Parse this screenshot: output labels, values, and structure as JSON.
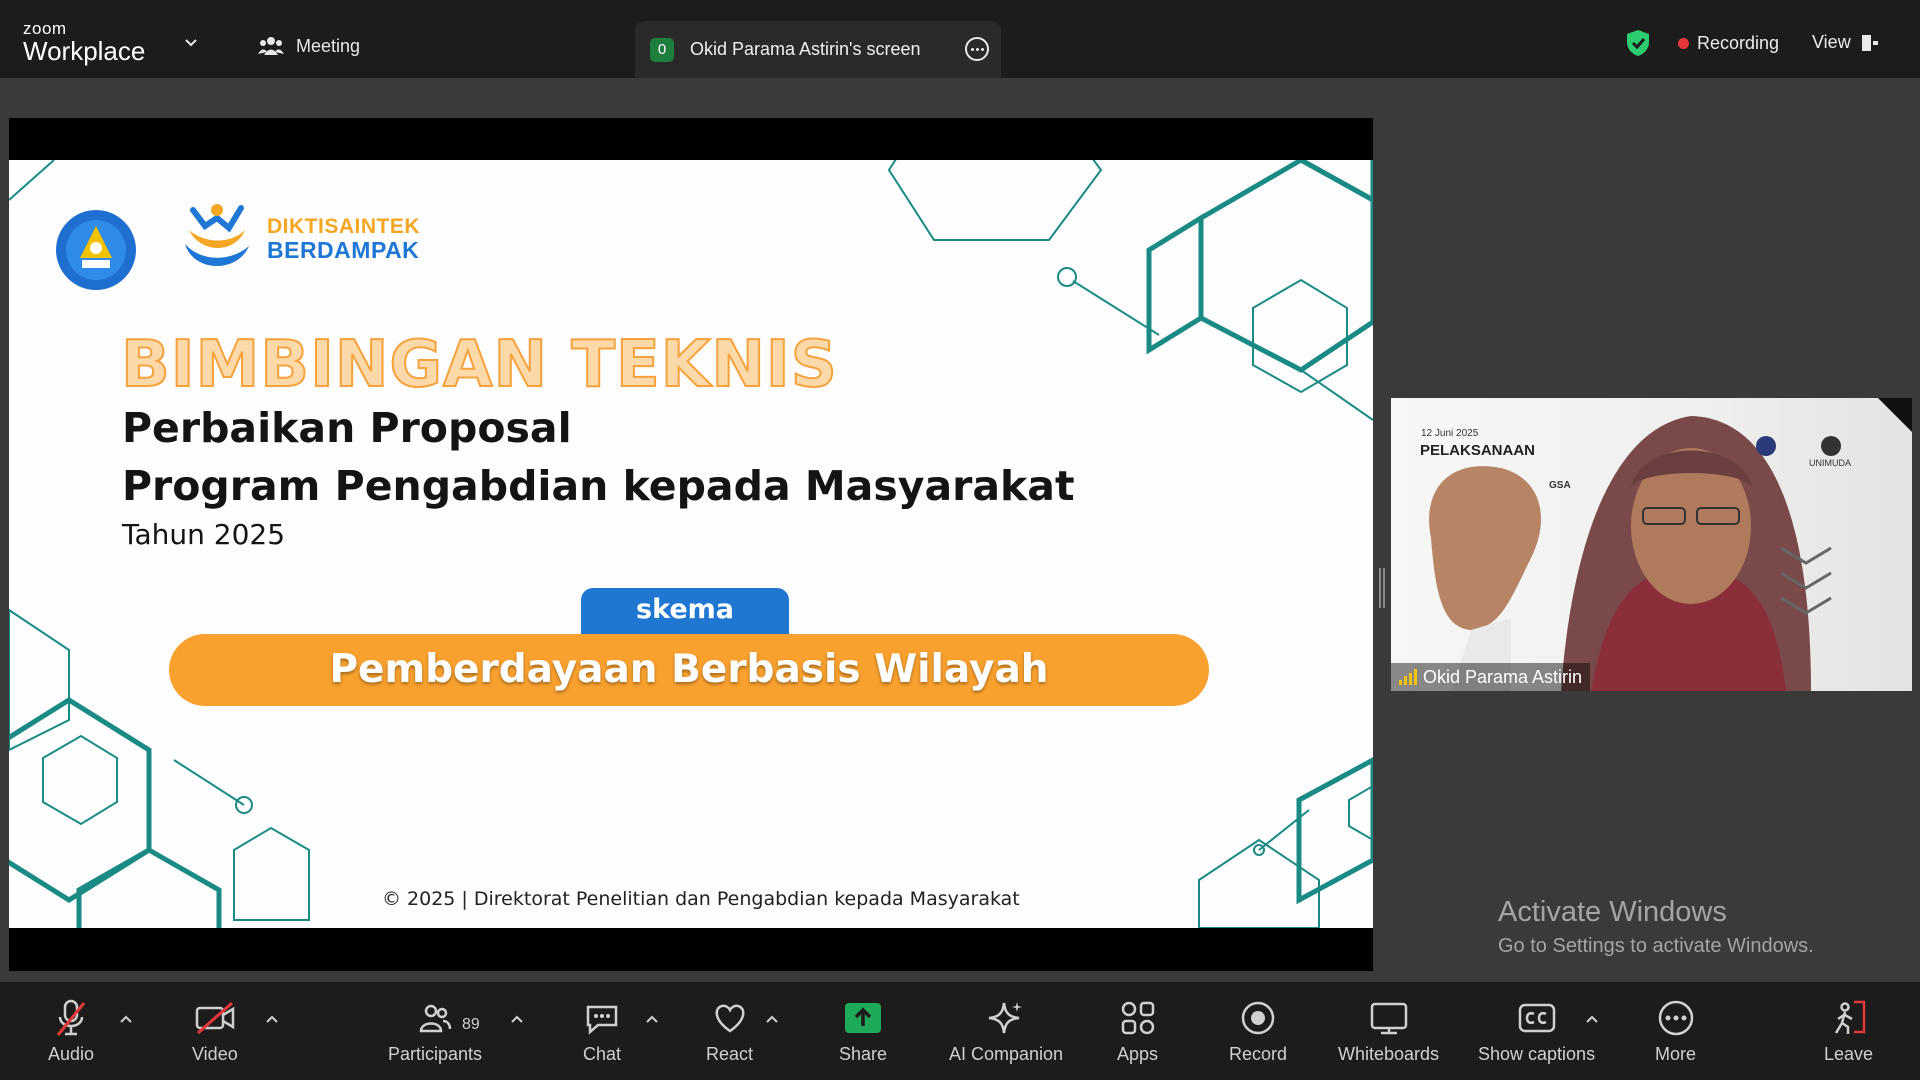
{
  "app": {
    "brand_line1": "zoom",
    "brand_line2": "Workplace",
    "meeting_label": "Meeting",
    "share_tab": {
      "badge": "0",
      "title": "Okid Parama Astirin's screen"
    },
    "recording_label": "Recording",
    "view_label": "View",
    "colors": {
      "recording_dot": "#e5383b",
      "shield": "#2ecc71",
      "share_green": "#1e7e3e"
    }
  },
  "slide": {
    "logo_text_line1": "DIKTISAINTEK",
    "logo_text_line2": "BERDAMPAK",
    "heading": "BIMBINGAN TEKNIS",
    "line1": "Perbaikan Proposal",
    "line2": "Program Pengabdian kepada Masyarakat",
    "year": "Tahun 2025",
    "scheme_tab": "skema",
    "scheme_name": "Pemberdayaan Berbasis Wilayah",
    "footer": "© 2025 | Direktorat Penelitian dan Pengabdian kepada Masyarakat",
    "colors": {
      "accent_orange": "#f9a12e",
      "teal": "#1a8a85",
      "blue": "#1f77d2"
    }
  },
  "participant": {
    "name": "Okid Parama Astirin",
    "bg_date": "12 Juni 2025",
    "bg_title": "PELAKSANAAN",
    "bg_fragment": "GSA",
    "bg_logo_text": "UNIMUDA"
  },
  "watermark": {
    "title": "Activate Windows",
    "subtitle": "Go to Settings to activate Windows."
  },
  "toolbar": {
    "audio": "Audio",
    "video": "Video",
    "participants": "Participants",
    "participants_count": "89",
    "chat": "Chat",
    "react": "React",
    "share": "Share",
    "ai_companion": "AI Companion",
    "apps": "Apps",
    "record": "Record",
    "whiteboards": "Whiteboards",
    "captions": "Show captions",
    "more": "More",
    "leave": "Leave"
  }
}
